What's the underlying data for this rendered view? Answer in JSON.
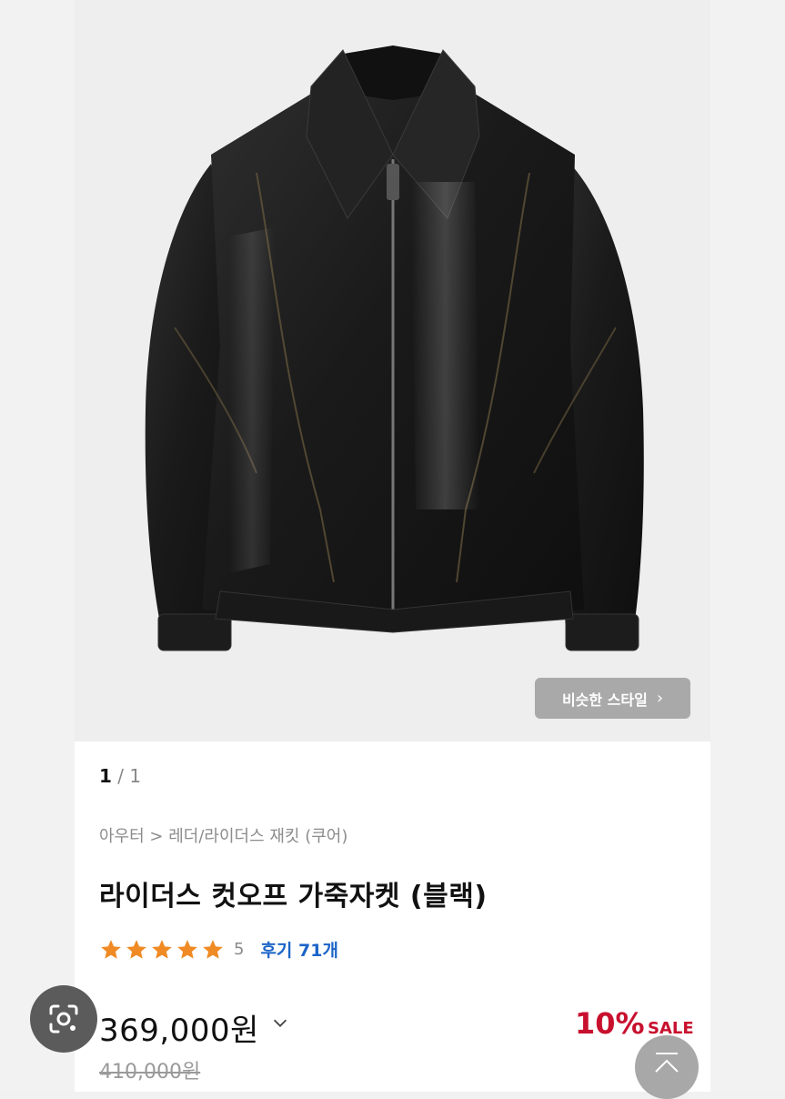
{
  "gallery": {
    "similar_style_label": "비슷한 스타일",
    "current_page": "1",
    "separator": "/",
    "total_pages": "1"
  },
  "product": {
    "breadcrumb": "아우터 > 레더/라이더스 재킷 (쿠어)",
    "title": "라이더스 컷오프 가죽자켓 (블랙)",
    "rating_value": 5,
    "rating_display": "5",
    "reviews_label": "후기 71개",
    "price": "369,000원",
    "discount_percent": "10%",
    "sale_label": "SALE",
    "original_price": "410,000원"
  },
  "icons": {
    "star": "star-icon",
    "price_toggle": "chevron-down-icon",
    "lens": "camera-lens-icon",
    "scroll_top": "chevron-up-icon",
    "similar_arrow": "chevron-right-icon"
  },
  "colors": {
    "star": "#f08a24",
    "review_link": "#1c64c8",
    "discount": "#c8102e",
    "similar_button": "#a9a9a9"
  }
}
